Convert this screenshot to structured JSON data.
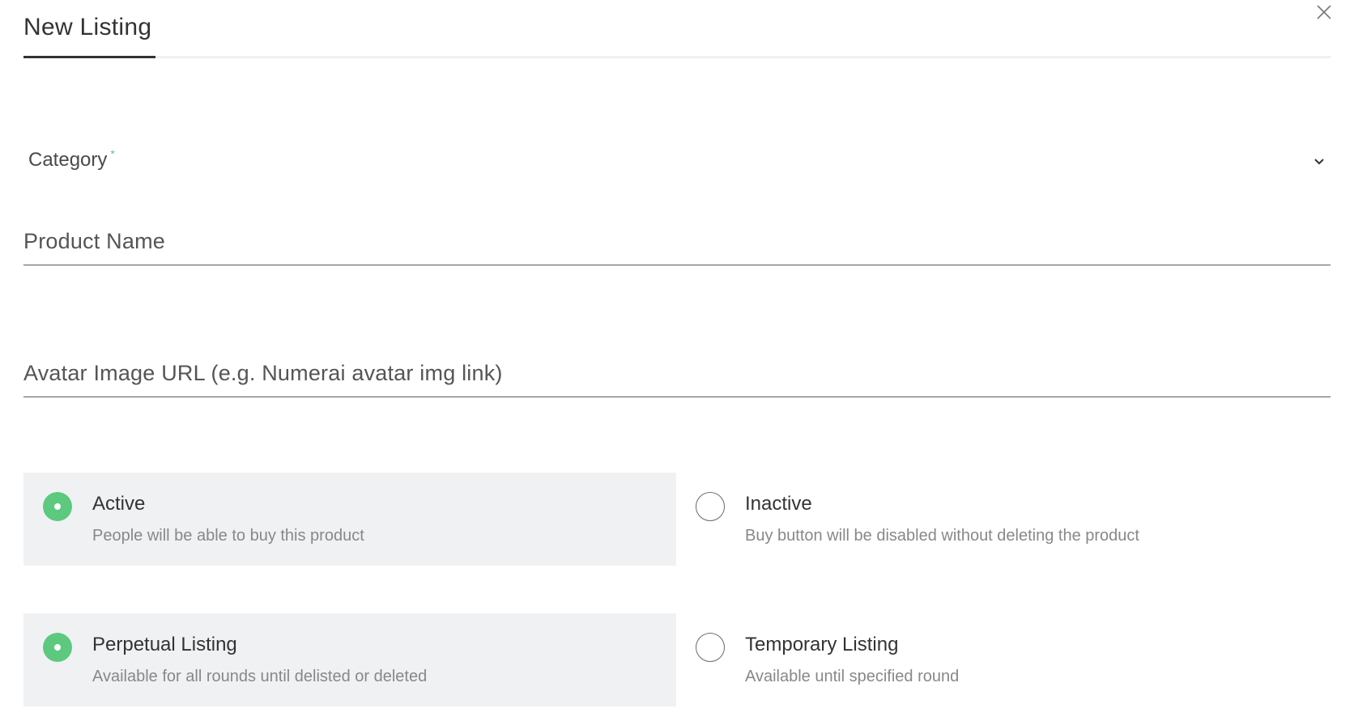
{
  "dialog": {
    "tab_label": "New Listing",
    "close_icon": "close-icon"
  },
  "form": {
    "category": {
      "label": "Category",
      "required_mark": "*",
      "icon": "chevron-down-icon"
    },
    "product_name": {
      "placeholder": "Product Name",
      "value": ""
    },
    "avatar_url": {
      "placeholder": "Avatar Image URL (e.g. Numerai avatar img link)",
      "value": ""
    },
    "status": {
      "selected": "active",
      "options": [
        {
          "id": "active",
          "title": "Active",
          "description": "People will be able to buy this product"
        },
        {
          "id": "inactive",
          "title": "Inactive",
          "description": "Buy button will be disabled without deleting the product"
        }
      ]
    },
    "listing_type": {
      "selected": "perpetual",
      "options": [
        {
          "id": "perpetual",
          "title": "Perpetual Listing",
          "description": "Available for all rounds until delisted or deleted"
        },
        {
          "id": "temporary",
          "title": "Temporary Listing",
          "description": "Available until specified round"
        }
      ]
    }
  },
  "colors": {
    "accent": "#5cc97e",
    "selected_bg": "#f0f1f3",
    "text_primary": "#333333",
    "text_secondary": "#888888"
  }
}
